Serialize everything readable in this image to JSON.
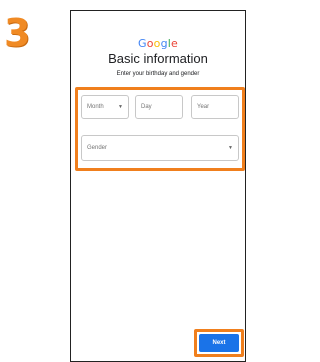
{
  "step": {
    "number": "3",
    "color": "#f08a24"
  },
  "screen": {
    "logo": {
      "letters": [
        "G",
        "o",
        "o",
        "g",
        "l",
        "e"
      ],
      "colors": [
        "#4285F4",
        "#EA4335",
        "#FBBC05",
        "#4285F4",
        "#34A853",
        "#EA4335"
      ]
    },
    "title": "Basic information",
    "subtitle": "Enter your birthday and gender",
    "month": {
      "placeholder": "Month",
      "icon": "chevron-down-icon"
    },
    "day": {
      "placeholder": "Day"
    },
    "year": {
      "placeholder": "Year"
    },
    "gender": {
      "placeholder": "Gender",
      "icon": "chevron-down-icon"
    },
    "next_label": "Next"
  },
  "colors": {
    "highlight": "#f07f1d",
    "primary_button": "#1a73e8"
  }
}
